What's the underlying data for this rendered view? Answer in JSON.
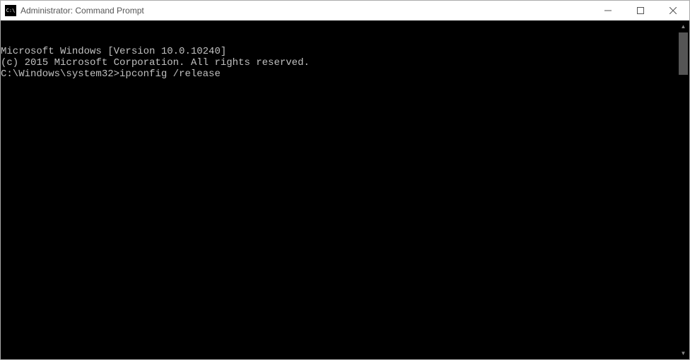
{
  "window": {
    "title": "Administrator: Command Prompt"
  },
  "terminal": {
    "line1": "Microsoft Windows [Version 10.0.10240]",
    "line2": "(c) 2015 Microsoft Corporation. All rights reserved.",
    "blank": "",
    "prompt": "C:\\Windows\\system32>",
    "command": "ipconfig /release"
  }
}
